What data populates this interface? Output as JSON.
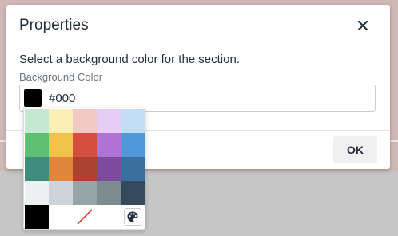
{
  "dialog": {
    "title": "Properties",
    "description": "Select a background color for the section.",
    "field_label": "Background Color",
    "color_value": "#000",
    "ok_label": "OK"
  },
  "palette": {
    "rows": [
      [
        "#c4e8d1",
        "#fbefb6",
        "#f2c8c2",
        "#e5cdf3",
        "#c2def2"
      ],
      [
        "#5fbf73",
        "#eec34a",
        "#d44d3f",
        "#b074d4",
        "#4f98d9"
      ],
      [
        "#3f8c7d",
        "#e1873b",
        "#ac4132",
        "#7d4a9e",
        "#3b6f9e"
      ],
      [
        "#ecf0f1",
        "#ced4d9",
        "#95a5a6",
        "#7f8c8d",
        "#34495e"
      ]
    ],
    "last_row_color": "#000000",
    "remove_icon": "remove-color-icon",
    "custom_icon": "palette-icon"
  },
  "colors": {
    "selected": "#000000",
    "backdrop": "#c6c6c6",
    "backdrop_top": "#d1b8b5",
    "remove_line": "#d9402f"
  }
}
